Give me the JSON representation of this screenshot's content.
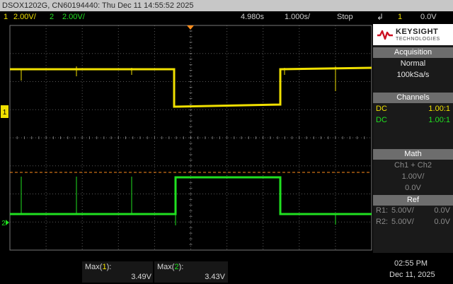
{
  "header": {
    "title": "DSOX1202G, CN60194440: Thu Dec 11 14:55:52 2025"
  },
  "topbar": {
    "ch1_num": "1",
    "ch1_scale": "2.00V/",
    "ch2_num": "2",
    "ch2_scale": "2.00V/",
    "time_pos": "4.980s",
    "time_scale": "1.000s/",
    "run_state": "Stop",
    "trig_level": "0.0V",
    "trig_source": "1"
  },
  "panel": {
    "brand_line1": "KEYSIGHT",
    "brand_line2": "TECHNOLOGIES",
    "acq_title": "Acquisition",
    "acq_mode": "Normal",
    "acq_rate": "100kSa/s",
    "ch_title": "Channels",
    "channels": [
      {
        "coupling": "DC",
        "probe": "1.00:1",
        "color": "#f0e000"
      },
      {
        "coupling": "DC",
        "probe": "1.00:1",
        "color": "#20e020"
      }
    ],
    "math_title": "Math",
    "math_func": "Ch1 + Ch2",
    "math_scale": "1.00V/",
    "math_offset": "0.0V",
    "ref_title": "Ref",
    "refs": [
      {
        "label": "R1:",
        "scale": "5.00V/",
        "offset": "0.0V"
      },
      {
        "label": "R2:",
        "scale": "5.00V/",
        "offset": "0.0V"
      }
    ]
  },
  "measurements": {
    "m1_pre": "Max(",
    "m1_ch": "1",
    "m1_post": "):",
    "m1_value": "3.49V",
    "m2_pre": "Max(",
    "m2_ch": "2",
    "m2_post": "):",
    "m2_value": "3.43V"
  },
  "clock": {
    "time": "02:55 PM",
    "date": "Dec 11, 2025"
  },
  "markers": {
    "ch1_ground": "1",
    "ch2_ground": "2",
    "trigger": "T"
  },
  "colors": {
    "ch1": "#f0e000",
    "ch2": "#20e020",
    "trigger": "#ff8c1a",
    "grid": "#5a5a5a",
    "header_bg": "#c7c7c7",
    "panel_section": "#6d6d6d",
    "brand_red": "#cc1122"
  }
}
